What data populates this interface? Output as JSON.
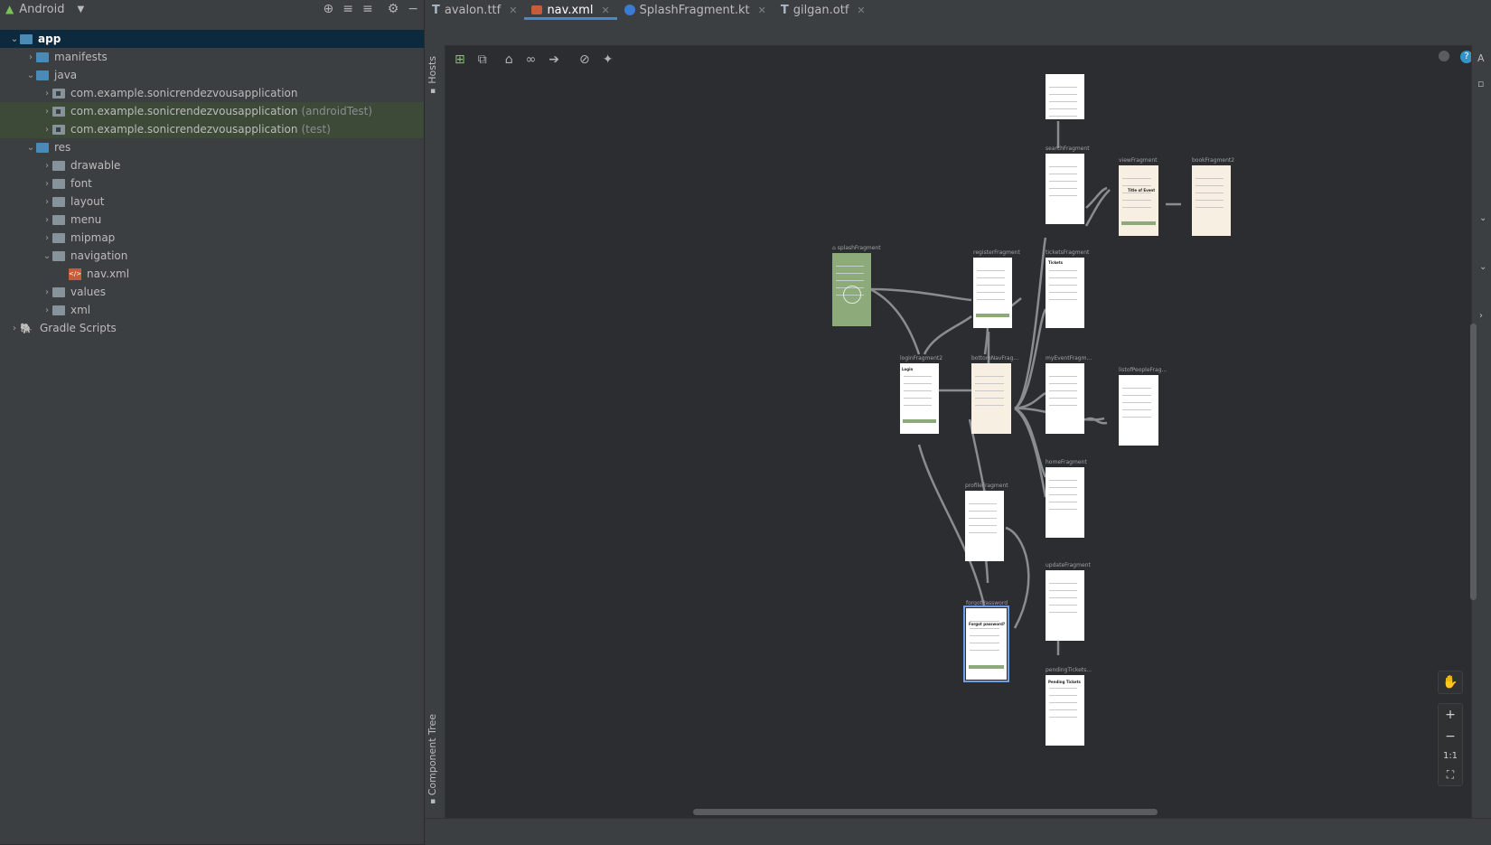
{
  "project_panel": {
    "view_selector": "Android",
    "tree": [
      {
        "label": "app",
        "suffix": "",
        "depth": 0,
        "chevron": "⌄",
        "icon": "module"
      },
      {
        "label": "manifests",
        "suffix": "",
        "depth": 1,
        "chevron": "›",
        "icon": "folder"
      },
      {
        "label": "java",
        "suffix": "",
        "depth": 1,
        "chevron": "⌄",
        "icon": "folder"
      },
      {
        "label": "com.example.sonicrendezvousapplication",
        "suffix": "",
        "depth": 2,
        "chevron": "›",
        "icon": "package"
      },
      {
        "label": "com.example.sonicrendezvousapplication",
        "suffix": "(androidTest)",
        "depth": 2,
        "chevron": "›",
        "icon": "package"
      },
      {
        "label": "com.example.sonicrendezvousapplication",
        "suffix": "(test)",
        "depth": 2,
        "chevron": "›",
        "icon": "package"
      },
      {
        "label": "res",
        "suffix": "",
        "depth": 1,
        "chevron": "⌄",
        "icon": "folder"
      },
      {
        "label": "drawable",
        "suffix": "",
        "depth": 2,
        "chevron": "›",
        "icon": "folder"
      },
      {
        "label": "font",
        "suffix": "",
        "depth": 2,
        "chevron": "›",
        "icon": "folder"
      },
      {
        "label": "layout",
        "suffix": "",
        "depth": 2,
        "chevron": "›",
        "icon": "folder"
      },
      {
        "label": "menu",
        "suffix": "",
        "depth": 2,
        "chevron": "›",
        "icon": "folder"
      },
      {
        "label": "mipmap",
        "suffix": "",
        "depth": 2,
        "chevron": "›",
        "icon": "folder"
      },
      {
        "label": "navigation",
        "suffix": "",
        "depth": 2,
        "chevron": "⌄",
        "icon": "folder"
      },
      {
        "label": "nav.xml",
        "suffix": "",
        "depth": 3,
        "chevron": "",
        "icon": "xml"
      },
      {
        "label": "values",
        "suffix": "",
        "depth": 2,
        "chevron": "›",
        "icon": "folder"
      },
      {
        "label": "xml",
        "suffix": "",
        "depth": 2,
        "chevron": "›",
        "icon": "folder"
      },
      {
        "label": "Gradle Scripts",
        "suffix": "",
        "depth": 0,
        "chevron": "›",
        "icon": "gradle"
      }
    ]
  },
  "tabs": [
    {
      "label": "avalon.ttf",
      "icon": "font-file-icon",
      "active": false
    },
    {
      "label": "nav.xml",
      "icon": "xml-file-icon",
      "active": true
    },
    {
      "label": "SplashFragment.kt",
      "icon": "kotlin-file-icon",
      "active": false
    },
    {
      "label": "gilgan.otf",
      "icon": "font-file-icon",
      "active": false
    }
  ],
  "side_panels": {
    "hosts": "Hosts",
    "component_tree": "Component Tree"
  },
  "zoom": {
    "one_to_one": "1:1"
  },
  "fragments": [
    {
      "label": "searchFragment",
      "style": "white"
    },
    {
      "label": "viewFragment",
      "style": "cream"
    },
    {
      "label": "bookFragment2",
      "style": "cream"
    },
    {
      "label": "splashFragment",
      "style": "green"
    },
    {
      "label": "registerFragment",
      "style": "white"
    },
    {
      "label": "ticketsFragment",
      "style": "white"
    },
    {
      "label": "loginFragment2",
      "style": "white"
    },
    {
      "label": "bottomNavFrag...",
      "style": "cream"
    },
    {
      "label": "myEventFragm...",
      "style": "white"
    },
    {
      "label": "listofPeopleFrag...",
      "style": "white"
    },
    {
      "label": "homeFragment",
      "style": "white"
    },
    {
      "label": "profileFragment",
      "style": "white"
    },
    {
      "label": "updateFragment",
      "style": "white"
    },
    {
      "label": "forgotPassword",
      "style": "white"
    },
    {
      "label": "pendingTickets...",
      "style": "white"
    },
    {
      "label": "",
      "style": "white"
    }
  ],
  "mini_text": {
    "view_title": "Title of Event",
    "tickets": "Tickets",
    "login": "Login",
    "forgot": "Forgot password?",
    "pending": "Pending Tickets"
  },
  "colors": {
    "accent": "#4a88c7",
    "fragment_green": "#8daa7a",
    "fragment_cream": "#f8efe3"
  }
}
